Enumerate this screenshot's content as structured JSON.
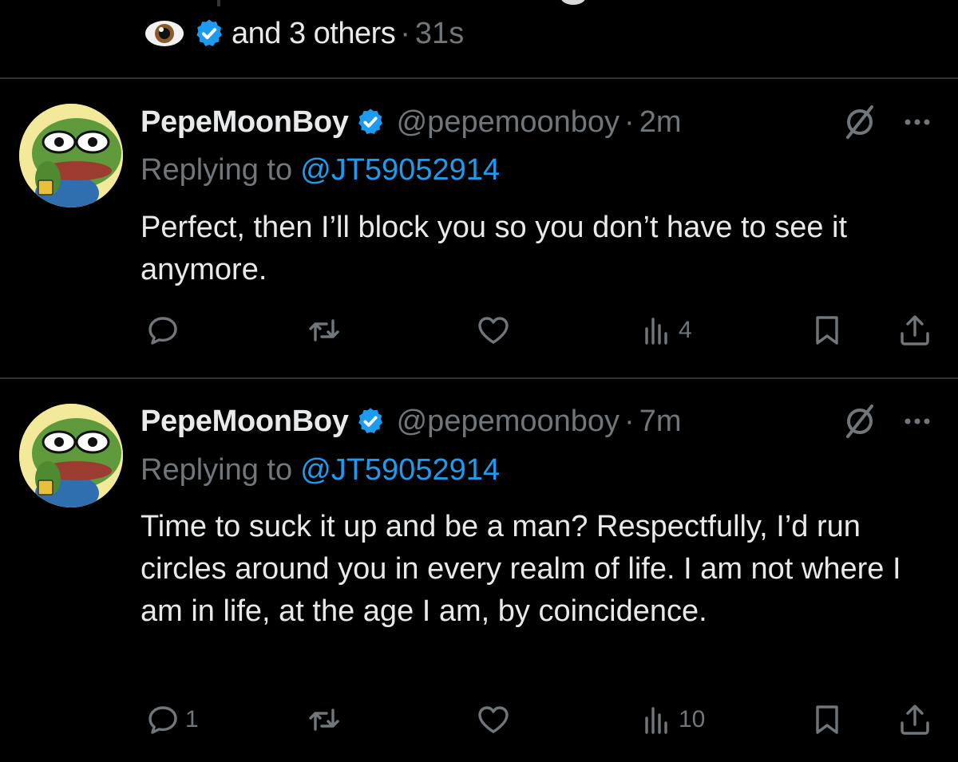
{
  "reactors": {
    "icons": [
      "eye-emoji-icon",
      "verified-badge-icon"
    ],
    "text": "and 3 others",
    "separator": "·",
    "time": "31s"
  },
  "tweets": [
    {
      "display_name": "PepeMoonBoy",
      "handle": "@pepemoonboy",
      "separator": "·",
      "time": "2m",
      "reply_prefix": "Replying to",
      "reply_to": "@JT59052914",
      "text": "Perfect, then I’ll block you so you don’t have to see it anymore.",
      "actions": {
        "reply_count": "",
        "retweet_count": "",
        "like_count": "",
        "view_count": "4"
      }
    },
    {
      "display_name": "PepeMoonBoy",
      "handle": "@pepemoonboy",
      "separator": "·",
      "time": "7m",
      "reply_prefix": "Replying to",
      "reply_to": "@JT59052914",
      "text": "Time to suck it up and be a man? Respectfully, I’d run circles around you in every realm of life. I am not where I am in life, at the age I am, by coincidence.",
      "actions": {
        "reply_count": "1",
        "retweet_count": "",
        "like_count": "",
        "view_count": "10"
      }
    }
  ],
  "colors": {
    "background": "#000000",
    "text_primary": "#e7e9ea",
    "text_secondary": "#71767b",
    "link": "#1d9bf0",
    "verified": "#1d9bf0",
    "divider": "#2f3336"
  }
}
